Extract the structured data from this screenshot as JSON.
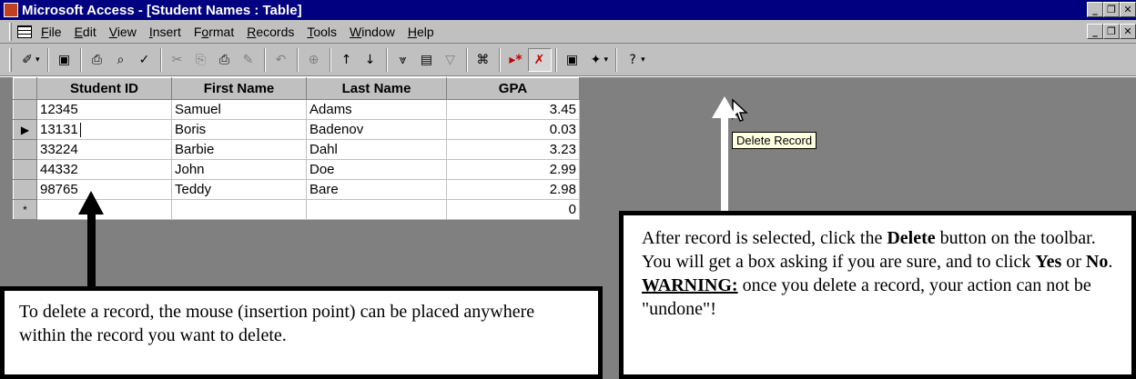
{
  "window": {
    "title": "Microsoft Access - [Student Names : Table]",
    "controls": [
      "_",
      "❐",
      "✕"
    ]
  },
  "menu": [
    {
      "label": "File",
      "key": "F"
    },
    {
      "label": "Edit",
      "key": "E"
    },
    {
      "label": "View",
      "key": "V"
    },
    {
      "label": "Insert",
      "key": "I"
    },
    {
      "label": "Format",
      "key": "o"
    },
    {
      "label": "Records",
      "key": "R"
    },
    {
      "label": "Tools",
      "key": "T"
    },
    {
      "label": "Window",
      "key": "W"
    },
    {
      "label": "Help",
      "key": "H"
    }
  ],
  "toolbar": {
    "buttons": [
      {
        "name": "view-design-icon",
        "glyph": "✐",
        "drop": true
      },
      {
        "sep": true
      },
      {
        "name": "save-icon",
        "glyph": "▣"
      },
      {
        "sep": true
      },
      {
        "name": "print-icon",
        "glyph": "⎙"
      },
      {
        "name": "print-preview-icon",
        "glyph": "⌕"
      },
      {
        "name": "spelling-icon",
        "glyph": "✓"
      },
      {
        "sep": true
      },
      {
        "name": "cut-icon",
        "glyph": "✂",
        "dim": true
      },
      {
        "name": "copy-icon",
        "glyph": "⎘",
        "dim": true
      },
      {
        "name": "paste-icon",
        "glyph": "⎙"
      },
      {
        "name": "format-painter-icon",
        "glyph": "✎",
        "dim": true
      },
      {
        "sep": true
      },
      {
        "name": "undo-icon",
        "glyph": "↶",
        "dim": true
      },
      {
        "sep": true
      },
      {
        "name": "hyperlink-icon",
        "glyph": "⊕",
        "dim": true
      },
      {
        "sep": true
      },
      {
        "name": "sort-ascending-icon",
        "glyph": "↑"
      },
      {
        "name": "sort-descending-icon",
        "glyph": "↓"
      },
      {
        "sep": true
      },
      {
        "name": "filter-by-selection-icon",
        "glyph": "⩔"
      },
      {
        "name": "filter-by-form-icon",
        "glyph": "▤"
      },
      {
        "name": "apply-filter-icon",
        "glyph": "▽",
        "dim": true
      },
      {
        "sep": true
      },
      {
        "name": "find-icon",
        "glyph": "⌘"
      },
      {
        "sep": true
      },
      {
        "name": "new-record-icon",
        "glyph": "▸*",
        "color": "#c00000"
      },
      {
        "name": "delete-record-icon",
        "glyph": "✗",
        "color": "#c00000",
        "pressed": true
      },
      {
        "sep": true
      },
      {
        "name": "database-window-icon",
        "glyph": "▣"
      },
      {
        "name": "new-object-icon",
        "glyph": "✦",
        "drop": true
      },
      {
        "sep": true
      },
      {
        "name": "help-icon",
        "glyph": "?",
        "drop": true
      }
    ]
  },
  "table": {
    "columns": [
      "Student ID",
      "First Name",
      "Last Name",
      "GPA"
    ],
    "rows": [
      [
        "12345",
        "Samuel",
        "Adams",
        "3.45"
      ],
      [
        "13131",
        "Boris",
        "Badenov",
        "0.03"
      ],
      [
        "33224",
        "Barbie",
        "Dahl",
        "3.23"
      ],
      [
        "44332",
        "John",
        "Doe",
        "2.99"
      ],
      [
        "98765",
        "Teddy",
        "Bare",
        "2.98"
      ]
    ],
    "new_row_gpa": "0",
    "new_row_marker": "*",
    "current_marker": "▶"
  },
  "tooltip": "Delete Record",
  "callouts": {
    "left": "To delete a record, the mouse (insertion point) can be placed anywhere within the record you want to delete.",
    "right": {
      "part1": "After record is selected, click the ",
      "bold1": "Delete",
      "part2": " button on the toolbar.  You will get a box asking if you are sure, and to click ",
      "bold2": "Yes",
      "part3": " or ",
      "bold3": "No",
      "part4": ".  ",
      "warning": "WARNING:",
      "part5": "  once you delete a record, your action can not be \"undone\"!"
    }
  }
}
